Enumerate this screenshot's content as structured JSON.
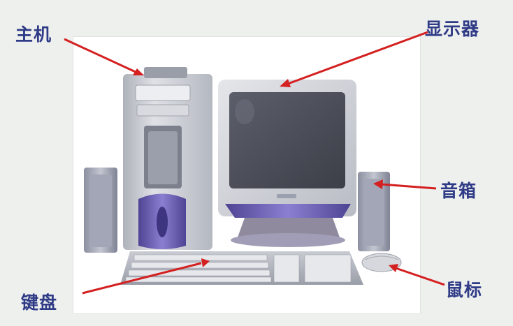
{
  "labels": {
    "host": "主机",
    "monitor": "显示器",
    "speaker": "音箱",
    "keyboard": "键盘",
    "mouse": "鼠标"
  },
  "colors": {
    "label_text": "#2f3b86",
    "arrow": "#d42020",
    "accent_purple": "#6a5fb0",
    "case_silver": "#c9ccd2",
    "screen": "#4b4e59",
    "background": "#eef0ee"
  }
}
